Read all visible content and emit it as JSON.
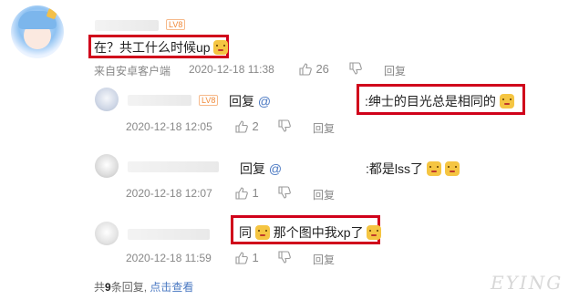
{
  "comment": {
    "text": "在？共工什么时候up",
    "source": "来自安卓客户端",
    "time": "2020-12-18 11:38",
    "likes": "26",
    "reply_label": "回复",
    "level_badge": "LV8"
  },
  "replies": [
    {
      "prefix": "回复",
      "at": "@",
      "text": ":绅士的目光总是相同的",
      "time": "2020-12-18 12:05",
      "likes": "2",
      "reply_label": "回复",
      "level_badge": "LV8"
    },
    {
      "prefix": "回复",
      "at": "@",
      "text": ":都是lss了",
      "time": "2020-12-18 12:07",
      "likes": "1",
      "reply_label": "回复"
    },
    {
      "text_a": "同",
      "text_b": "那个图中我xp了",
      "time": "2020-12-18 11:59",
      "likes": "1",
      "reply_label": "回复"
    }
  ],
  "footer": {
    "count_prefix": "共",
    "count": "9",
    "count_suffix": "条回复,",
    "view_link": "点击查看"
  },
  "watermark": "EYING"
}
